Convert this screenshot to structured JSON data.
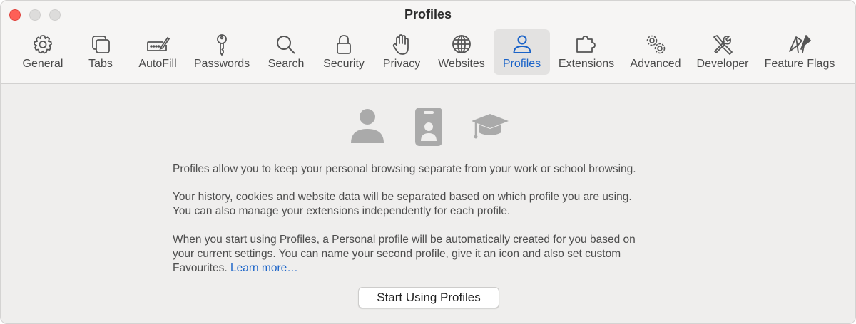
{
  "window": {
    "title": "Profiles"
  },
  "toolbar": {
    "tabs": [
      {
        "id": "general",
        "label": "General",
        "icon": "gear-icon"
      },
      {
        "id": "tabs",
        "label": "Tabs",
        "icon": "tabs-icon"
      },
      {
        "id": "autofill",
        "label": "AutoFill",
        "icon": "autofill-icon"
      },
      {
        "id": "passwords",
        "label": "Passwords",
        "icon": "key-icon"
      },
      {
        "id": "search",
        "label": "Search",
        "icon": "magnifier-icon"
      },
      {
        "id": "security",
        "label": "Security",
        "icon": "lock-icon"
      },
      {
        "id": "privacy",
        "label": "Privacy",
        "icon": "hand-icon"
      },
      {
        "id": "websites",
        "label": "Websites",
        "icon": "globe-icon"
      },
      {
        "id": "profiles",
        "label": "Profiles",
        "icon": "person-icon",
        "active": true
      },
      {
        "id": "extensions",
        "label": "Extensions",
        "icon": "puzzle-icon"
      },
      {
        "id": "advanced",
        "label": "Advanced",
        "icon": "gears-icon"
      },
      {
        "id": "developer",
        "label": "Developer",
        "icon": "tools-icon"
      },
      {
        "id": "featureflags",
        "label": "Feature Flags",
        "icon": "flags-icon"
      }
    ],
    "accent_color": "#1a63c8"
  },
  "profiles": {
    "icons": [
      "person-icon",
      "id-badge-icon",
      "graduation-cap-icon"
    ],
    "para1": "Profiles allow you to keep your personal browsing separate from your work or school browsing.",
    "para2_line1": "Your history, cookies and website data will be separated based on which profile you are using.",
    "para2_line2": "You can also manage your extensions independently for each profile.",
    "para3_line1": "When you start using Profiles, a Personal profile will be automatically created for you based on",
    "para3_line2": "your current settings. You can name your second profile, give it an icon and also set custom",
    "para3_line3_prefix": "Favourites. ",
    "learn_more": "Learn more…",
    "start_button": "Start Using Profiles"
  }
}
